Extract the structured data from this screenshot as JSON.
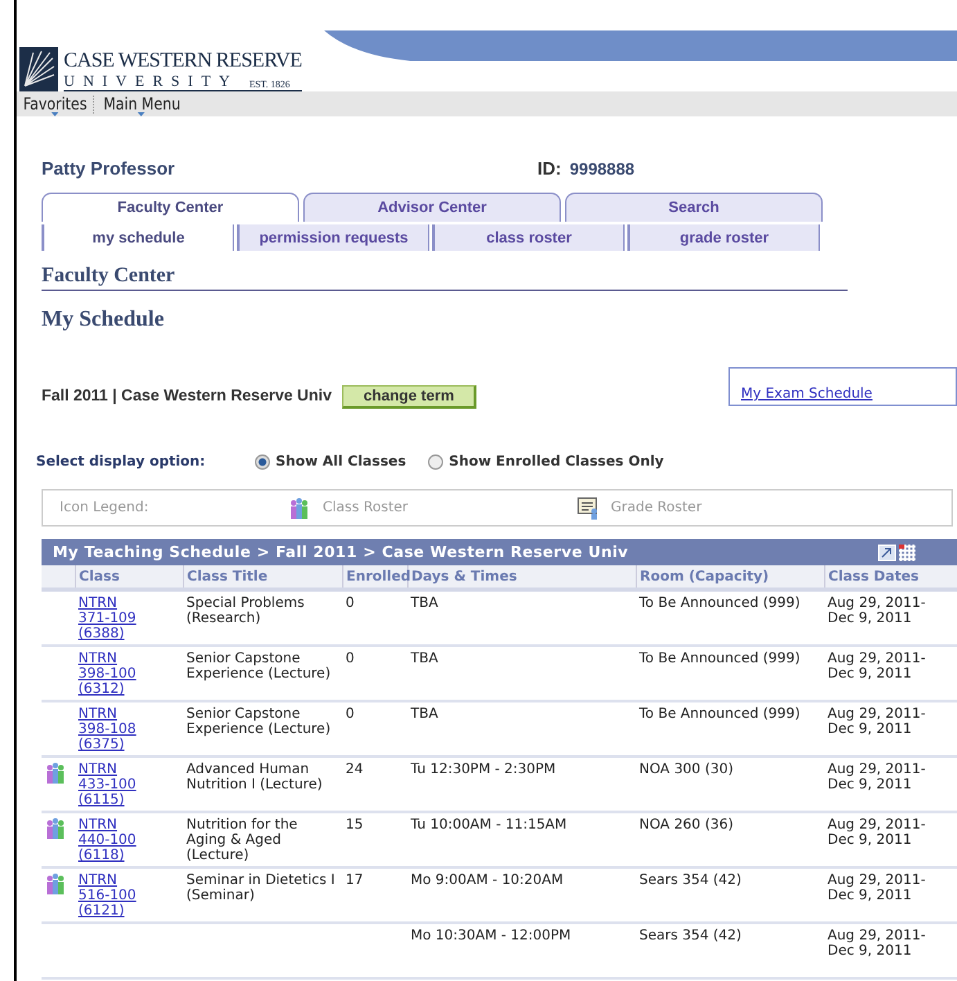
{
  "header": {
    "logo_name": "CASE WESTERN RESERVE",
    "logo_sub": "UNIVERSITY",
    "logo_est": "EST. 1826"
  },
  "menu": [
    {
      "label": "Favorites"
    },
    {
      "label": "Main Menu"
    }
  ],
  "person": {
    "name": "Patty Professor",
    "id_label": "ID:",
    "id": "9998888"
  },
  "tabs": [
    {
      "label": "Faculty Center",
      "selected": true
    },
    {
      "label": "Advisor Center",
      "selected": false
    },
    {
      "label": "Search",
      "selected": false
    }
  ],
  "subtabs": [
    {
      "label": "my schedule",
      "selected": true
    },
    {
      "label": "permission requests",
      "selected": false
    },
    {
      "label": "class roster",
      "selected": false
    },
    {
      "label": "grade roster",
      "selected": false
    }
  ],
  "section_title": "Faculty Center",
  "page_title": "My Schedule",
  "term": {
    "label": "Fall 2011 | Case Western Reserve Univ",
    "button": "change term",
    "exam_link": "My Exam Schedule"
  },
  "display_option": {
    "label": "Select display option:",
    "options": [
      {
        "label": "Show All Classes",
        "selected": true
      },
      {
        "label": "Show Enrolled Classes Only",
        "selected": false
      }
    ]
  },
  "legend": {
    "label": "Icon Legend:",
    "items": [
      {
        "kind": "class_roster",
        "label": "Class Roster"
      },
      {
        "kind": "grade_roster",
        "label": "Grade Roster"
      }
    ]
  },
  "table": {
    "title": "My Teaching Schedule > Fall 2011 > Case Western Reserve Univ",
    "columns": [
      "Class",
      "Class Title",
      "Enrolled",
      "Days & Times",
      "Room (Capacity)",
      "Class Dates"
    ],
    "rows": [
      {
        "roster_icon": false,
        "class": "NTRN 371-109 (6388)",
        "title": "Special Problems (Research)",
        "enrolled": "0",
        "days": "TBA",
        "room": "To Be Announced (999)",
        "dates": "Aug 29, 2011- Dec 9, 2011"
      },
      {
        "roster_icon": false,
        "class": "NTRN 398-100 (6312)",
        "title": "Senior Capstone Experience (Lecture)",
        "enrolled": "0",
        "days": "TBA",
        "room": "To Be Announced (999)",
        "dates": "Aug 29, 2011- Dec 9, 2011"
      },
      {
        "roster_icon": false,
        "class": "NTRN 398-108 (6375)",
        "title": "Senior Capstone Experience (Lecture)",
        "enrolled": "0",
        "days": "TBA",
        "room": "To Be Announced (999)",
        "dates": "Aug 29, 2011- Dec 9, 2011"
      },
      {
        "roster_icon": true,
        "class": "NTRN 433-100 (6115)",
        "title": "Advanced Human Nutrition I (Lecture)",
        "enrolled": "24",
        "days": "Tu 12:30PM - 2:30PM",
        "room": "NOA 300 (30)",
        "dates": "Aug 29, 2011- Dec 9, 2011"
      },
      {
        "roster_icon": true,
        "class": "NTRN 440-100 (6118)",
        "title": "Nutrition for the Aging & Aged (Lecture)",
        "enrolled": "15",
        "days": "Tu 10:00AM - 11:15AM",
        "room": "NOA 260 (36)",
        "dates": "Aug 29, 2011- Dec 9, 2011"
      },
      {
        "roster_icon": true,
        "class": "NTRN 516-100 (6121)",
        "title": "Seminar in Dietetics I (Seminar)",
        "enrolled": "17",
        "days": "Mo 9:00AM - 10:20AM",
        "room": "Sears 354 (42)",
        "dates": "Aug 29, 2011- Dec 9, 2011"
      },
      {
        "roster_icon": false,
        "days": "Mo 10:30AM - 12:00PM",
        "room": "Sears 354 (42)",
        "dates": "Aug 29, 2011- Dec 9, 2011"
      }
    ]
  }
}
